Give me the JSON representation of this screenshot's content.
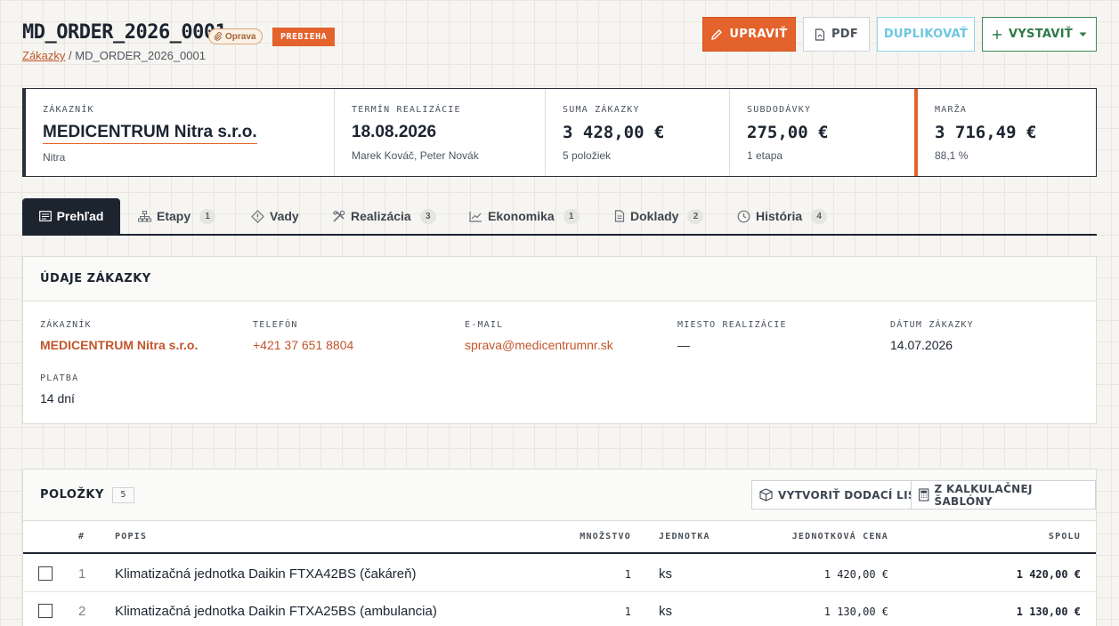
{
  "header": {
    "title": "MD_ORDER_2026_0001",
    "type_tag": "Oprava",
    "status": "PREBIEHA",
    "breadcrumb_link": "Zákazky",
    "breadcrumb_sep": "/",
    "breadcrumb_current": "MD_ORDER_2026_0001"
  },
  "actions": {
    "edit": "UPRAVIŤ",
    "pdf": "PDF",
    "duplicate": "DUPLIKOVAŤ",
    "issue": "VYSTAVIŤ"
  },
  "summary": {
    "customer": {
      "label": "ZÁKAZNÍK",
      "value": "MEDICENTRUM Nitra s.r.o.",
      "sub": "Nitra"
    },
    "deadline": {
      "label": "TERMÍN REALIZÁCIE",
      "value": "18.08.2026",
      "sub": "Marek Kováč, Peter Novák"
    },
    "order_sum": {
      "label": "SUMA ZÁKAZKY",
      "value": "3 428,00 €",
      "sub": "5 položiek"
    },
    "subcontracts": {
      "label": "SUBDODÁVKY",
      "value": "275,00 €",
      "sub": "1 etapa"
    },
    "margin": {
      "label": "MARŽA",
      "value": "3 716,49 €",
      "sub": "88,1 %"
    }
  },
  "tabs": [
    {
      "label": "Prehľad",
      "count": ""
    },
    {
      "label": "Etapy",
      "count": "1"
    },
    {
      "label": "Vady",
      "count": ""
    },
    {
      "label": "Realizácia",
      "count": "3"
    },
    {
      "label": "Ekonomika",
      "count": "1"
    },
    {
      "label": "Doklady",
      "count": "2"
    },
    {
      "label": "História",
      "count": "4"
    }
  ],
  "details": {
    "title": "ÚDAJE ZÁKAZKY",
    "customer": {
      "label": "ZÁKAZNÍK",
      "value": "MEDICENTRUM Nitra s.r.o."
    },
    "phone": {
      "label": "TELEFÓN",
      "value": "+421 37 651 8804"
    },
    "email": {
      "label": "E-MAIL",
      "value": "sprava@medicentrumnr.sk"
    },
    "place": {
      "label": "MIESTO REALIZÁCIE",
      "value": "—"
    },
    "date": {
      "label": "DÁTUM ZÁKAZKY",
      "value": "14.07.2026"
    },
    "payment": {
      "label": "PLATBA",
      "value": "14 dní"
    }
  },
  "items": {
    "title": "POLOŽKY",
    "count": "5",
    "btn_delivery": "VYTVORIŤ DODACÍ LIST",
    "btn_template": "Z KALKULAČNEJ ŠABLÓNY",
    "columns": {
      "num": "#",
      "desc": "POPIS",
      "qty": "MNOŽSTVO",
      "unit": "JEDNOTKA",
      "unit_price": "JEDNOTKOVÁ CENA",
      "total": "SPOLU"
    },
    "rows": [
      {
        "num": "1",
        "desc": "Klimatizačná jednotka Daikin FTXA42BS (čakáreň)",
        "qty": "1",
        "unit": "ks",
        "unit_price": "1 420,00 €",
        "total": "1 420,00 €"
      },
      {
        "num": "2",
        "desc": "Klimatizačná jednotka Daikin FTXA25BS (ambulancia)",
        "qty": "1",
        "unit": "ks",
        "unit_price": "1 130,00 €",
        "total": "1 130,00 €"
      }
    ]
  },
  "colors": {
    "accent": "#e4622c",
    "dark": "#1c2430",
    "link": "#c2552a",
    "success": "#2f7a47",
    "info": "#6cc6e0"
  }
}
